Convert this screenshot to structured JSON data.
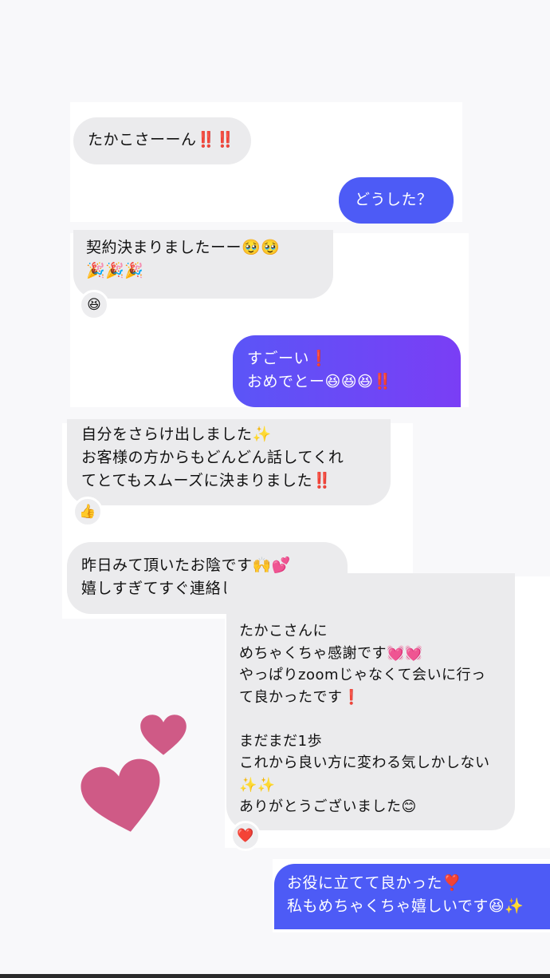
{
  "messages": [
    {
      "id": "m1",
      "direction": "incoming",
      "text": "たかこさーーん‼️‼️"
    },
    {
      "id": "m2",
      "direction": "outgoing",
      "text": "どうした？"
    },
    {
      "id": "m3",
      "direction": "incoming",
      "text": "契約決まりましたーー🥹🥹\n🎉🎉🎉",
      "reaction": "😆"
    },
    {
      "id": "m4",
      "direction": "outgoing",
      "text": "すごーい❗️\nおめでとー😆😆😆‼️"
    },
    {
      "id": "m5",
      "direction": "incoming",
      "text": "自分をさらけ出しました✨\nお客様の方からもどんどん話してくれ\nてとてもスムーズに決まりました‼️",
      "reaction": "👍"
    },
    {
      "id": "m6",
      "direction": "incoming",
      "text": "昨日みて頂いたお陰です🙌💕\n嬉しすぎてすぐ連絡しました🤣"
    },
    {
      "id": "m7",
      "direction": "incoming",
      "text": "たかこさんに\nめちゃくちゃ感謝です💓💓\nやっぱりzoomじゃなくて会いに行っ\nて良かったです❗️\n\nまだまだ1歩\nこれから良い方に変わる気しかしない\n✨✨\nありがとうございました😊",
      "reaction": "❤️"
    },
    {
      "id": "m8",
      "direction": "outgoing",
      "text": "お役に立てて良かった❣️\n私もめちゃくちゃ嬉しいです😆✨"
    }
  ],
  "colors": {
    "incoming_bubble": "#ebebed",
    "outgoing_bubble": "#4d5bf6",
    "sticker_heart": "#cf5a86"
  },
  "sticker": "pink-hearts"
}
